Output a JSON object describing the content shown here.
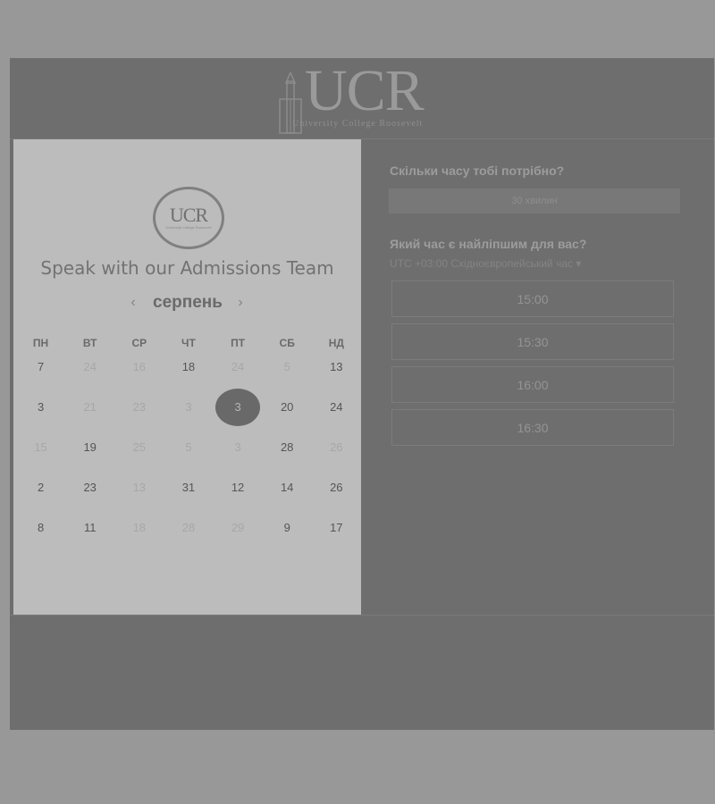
{
  "brand": {
    "name": "UCR",
    "tagline": "University College Roosevelt"
  },
  "left_panel": {
    "title": "Speak with our Admissions Team",
    "month": "серпень",
    "prev_icon": "chevron-left-icon",
    "next_icon": "chevron-right-icon",
    "weekdays": [
      "ПН",
      "ВТ",
      "СР",
      "ЧТ",
      "ПТ",
      "СБ",
      "НД"
    ],
    "weeks": [
      [
        {
          "day": "7",
          "available": true
        },
        {
          "day": "24",
          "available": false
        },
        {
          "day": "16",
          "available": false
        },
        {
          "day": "18",
          "available": true
        },
        {
          "day": "24",
          "available": false
        },
        {
          "day": "5",
          "available": false
        },
        {
          "day": "13",
          "available": true
        }
      ],
      [
        {
          "day": "3",
          "available": true
        },
        {
          "day": "21",
          "available": false
        },
        {
          "day": "23",
          "available": false
        },
        {
          "day": "3",
          "available": false
        },
        {
          "day": "3",
          "available": true,
          "selected": true
        },
        {
          "day": "20",
          "available": true
        },
        {
          "day": "24",
          "available": true
        }
      ],
      [
        {
          "day": "15",
          "available": false
        },
        {
          "day": "19",
          "available": true
        },
        {
          "day": "25",
          "available": false
        },
        {
          "day": "5",
          "available": false
        },
        {
          "day": "3",
          "available": false
        },
        {
          "day": "28",
          "available": true
        },
        {
          "day": "26",
          "available": false
        }
      ],
      [
        {
          "day": "2",
          "available": true
        },
        {
          "day": "23",
          "available": true
        },
        {
          "day": "13",
          "available": false
        },
        {
          "day": "31",
          "available": true
        },
        {
          "day": "12",
          "available": true
        },
        {
          "day": "14",
          "available": true
        },
        {
          "day": "26",
          "available": true
        }
      ],
      [
        {
          "day": "8",
          "available": true
        },
        {
          "day": "11",
          "available": true
        },
        {
          "day": "18",
          "available": false
        },
        {
          "day": "28",
          "available": false
        },
        {
          "day": "29",
          "available": false
        },
        {
          "day": "9",
          "available": true
        },
        {
          "day": "17",
          "available": true
        }
      ]
    ]
  },
  "right_panel": {
    "duration_label": "Скільки часу тобі потрібно?",
    "duration_value": "30 хвилин",
    "time_label": "Який час є найліпшим для вас?",
    "timezone": "UTC +03:00 Східноєвропейський час",
    "timezone_icon": "caret-down-icon",
    "slots": [
      "15:00",
      "15:30",
      "16:00",
      "16:30"
    ]
  }
}
